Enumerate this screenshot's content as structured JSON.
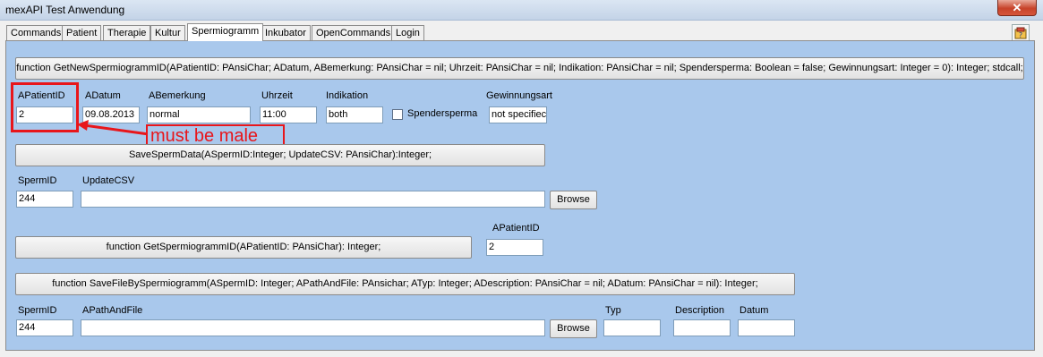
{
  "window": {
    "title": "mexAPI Test Anwendung",
    "close_glyph": "✕"
  },
  "tabs": [
    {
      "label": "Commands"
    },
    {
      "label": "Patient"
    },
    {
      "label": "Therapie"
    },
    {
      "label": "Kultur"
    },
    {
      "label": "Spermiogramm",
      "active": true
    },
    {
      "label": "Inkubator"
    },
    {
      "label": "OpenCommands"
    },
    {
      "label": "Login"
    }
  ],
  "help_icon": "help-book-icon",
  "section1": {
    "button": "function GetNewSpermiogrammID(APatientID: PAnsiChar; ADatum, ABemerkung: PAnsiChar = nil; Uhrzeit: PAnsiChar = nil; Indikation: PAnsiChar = nil; Spendersperma: Boolean = false; Gewinnungsart: Integer = 0): Integer; stdcall;",
    "labels": {
      "patientid": "APatientID",
      "datum": "ADatum",
      "bemerkung": "ABemerkung",
      "uhrzeit": "Uhrzeit",
      "indikation": "Indikation",
      "spendersperma": "Spendersperma",
      "gewinnungsart": "Gewinnungsart"
    },
    "values": {
      "patientid": "2",
      "datum": "09.08.2013",
      "bemerkung": "normal",
      "uhrzeit": "11:00",
      "indikation": "both",
      "gewinnungsart": "not specifiec"
    },
    "spendersperma_checked": false
  },
  "annotation": {
    "text": "must be male",
    "color": "#e8161b"
  },
  "section2": {
    "button": "SaveSpermData(ASpermID:Integer; UpdateCSV: PAnsiChar):Integer;",
    "labels": {
      "spermid": "SpermID",
      "updatecsv": "UpdateCSV"
    },
    "values": {
      "spermid": "244",
      "updatecsv": ""
    },
    "browse": "Browse"
  },
  "section3": {
    "button": "function GetSpermiogrammID(APatientID: PAnsiChar): Integer;",
    "labels": {
      "patientid": "APatientID"
    },
    "values": {
      "patientid": "2"
    }
  },
  "section4": {
    "button": "function SaveFileBySpermiogramm(ASpermID: Integer; APathAndFile: PAnsichar; ATyp: Integer; ADescription: PAnsiChar = nil; ADatum: PAnsiChar = nil): Integer;",
    "labels": {
      "spermid": "SpermID",
      "pathandfile": "APathAndFile",
      "typ": "Typ",
      "description": "Description",
      "datum": "Datum"
    },
    "values": {
      "spermid": "244",
      "pathandfile": "",
      "typ": "",
      "description": "",
      "datum": ""
    },
    "browse": "Browse"
  },
  "colors": {
    "page_bg": "#a9c8ec",
    "frame_bg": "#f0f0f0",
    "annotation": "#e8161b"
  }
}
